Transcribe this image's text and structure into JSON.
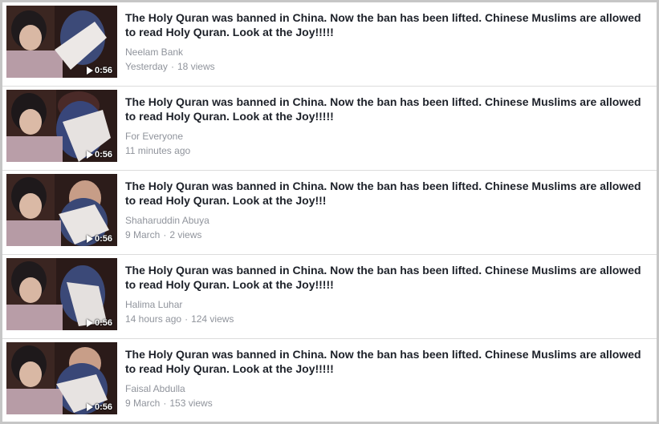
{
  "videos": [
    {
      "title": "The Holy Quran was banned in China. Now the ban has been lifted. Chinese Muslims are allowed to read Holy Quran. Look at the Joy!!!!!",
      "author": "Neelam Bank",
      "time": "Yesterday",
      "separator": "·",
      "views": "18 views",
      "duration": "0:56"
    },
    {
      "title": "The Holy Quran was banned in China. Now the ban has been lifted. Chinese Muslims are allowed to read Holy Quran. Look at the Joy!!!!!",
      "author": "For Everyone",
      "time": "11 minutes ago",
      "separator": "",
      "views": "",
      "duration": "0:56"
    },
    {
      "title": "The Holy Quran was banned in China. Now the ban has been lifted. Chinese Muslims are allowed to read Holy Quran. Look at the Joy!!!",
      "author": "Shaharuddin Abuya",
      "time": "9 March",
      "separator": "·",
      "views": "2 views",
      "duration": "0:56"
    },
    {
      "title": "The Holy Quran was banned in China. Now the ban has been lifted. Chinese Muslims are allowed to read Holy Quran. Look at the Joy!!!!!",
      "author": "Halima Luhar",
      "time": "14 hours ago",
      "separator": "·",
      "views": "124 views",
      "duration": "0:56"
    },
    {
      "title": "The Holy Quran was banned in China. Now the ban has been lifted. Chinese Muslims are allowed to read Holy Quran. Look at the Joy!!!!!",
      "author": "Faisal Abdulla",
      "time": "9 March",
      "separator": "·",
      "views": "153 views",
      "duration": "0:56"
    }
  ]
}
